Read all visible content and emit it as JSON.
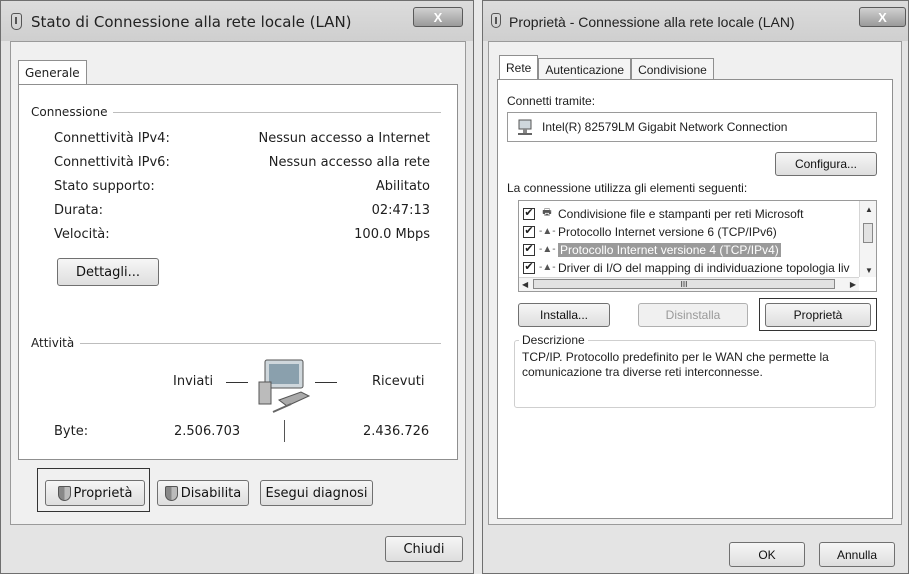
{
  "left_window": {
    "title": "Stato di Connessione alla rete locale (LAN)",
    "close_label": "X",
    "tabs": [
      "Generale"
    ],
    "connection_group": "Connessione",
    "rows": [
      {
        "label": "Connettività IPv4:",
        "value": "Nessun accesso a Internet"
      },
      {
        "label": "Connettività IPv6:",
        "value": "Nessun accesso alla rete"
      },
      {
        "label": "Stato supporto:",
        "value": "Abilitato"
      },
      {
        "label": "Durata:",
        "value": "02:47:13"
      },
      {
        "label": "Velocità:",
        "value": "100.0 Mbps"
      }
    ],
    "details_button": "Dettagli...",
    "activity_group": "Attività",
    "sent_label": "Inviati",
    "received_label": "Ricevuti",
    "bytes_label": "Byte:",
    "bytes_sent": "2.506.703",
    "bytes_received": "2.436.726",
    "properties_button": "Proprietà",
    "disable_button": "Disabilita",
    "diagnose_button": "Esegui diagnosi",
    "close_button": "Chiudi"
  },
  "right_window": {
    "title": "Proprietà - Connessione alla rete locale (LAN)",
    "close_label": "X",
    "tabs": [
      "Rete",
      "Autenticazione",
      "Condivisione"
    ],
    "connect_using_label": "Connetti tramite:",
    "adapter_name": "Intel(R) 82579LM Gigabit Network Connection",
    "configure_button": "Configura...",
    "items_label": "La connessione utilizza gli elementi seguenti:",
    "items": [
      {
        "label": "Condivisione file e stampanti per reti Microsoft",
        "checked": true,
        "selected": false
      },
      {
        "label": "Protocollo Internet versione 6 (TCP/IPv6)",
        "checked": true,
        "selected": false
      },
      {
        "label": "Protocollo Internet versione 4 (TCP/IPv4)",
        "checked": true,
        "selected": true
      },
      {
        "label": "Driver di I/O del mapping di individuazione topologia liv",
        "checked": true,
        "selected": false
      }
    ],
    "scroll_thumb_label": "III",
    "install_button": "Installa...",
    "uninstall_button": "Disinstalla",
    "properties_button": "Proprietà",
    "description_group": "Descrizione",
    "description_text": "TCP/IP. Protocollo predefinito per le WAN che permette la comunicazione tra diverse reti interconnesse.",
    "ok_button": "OK",
    "cancel_button": "Annulla"
  }
}
